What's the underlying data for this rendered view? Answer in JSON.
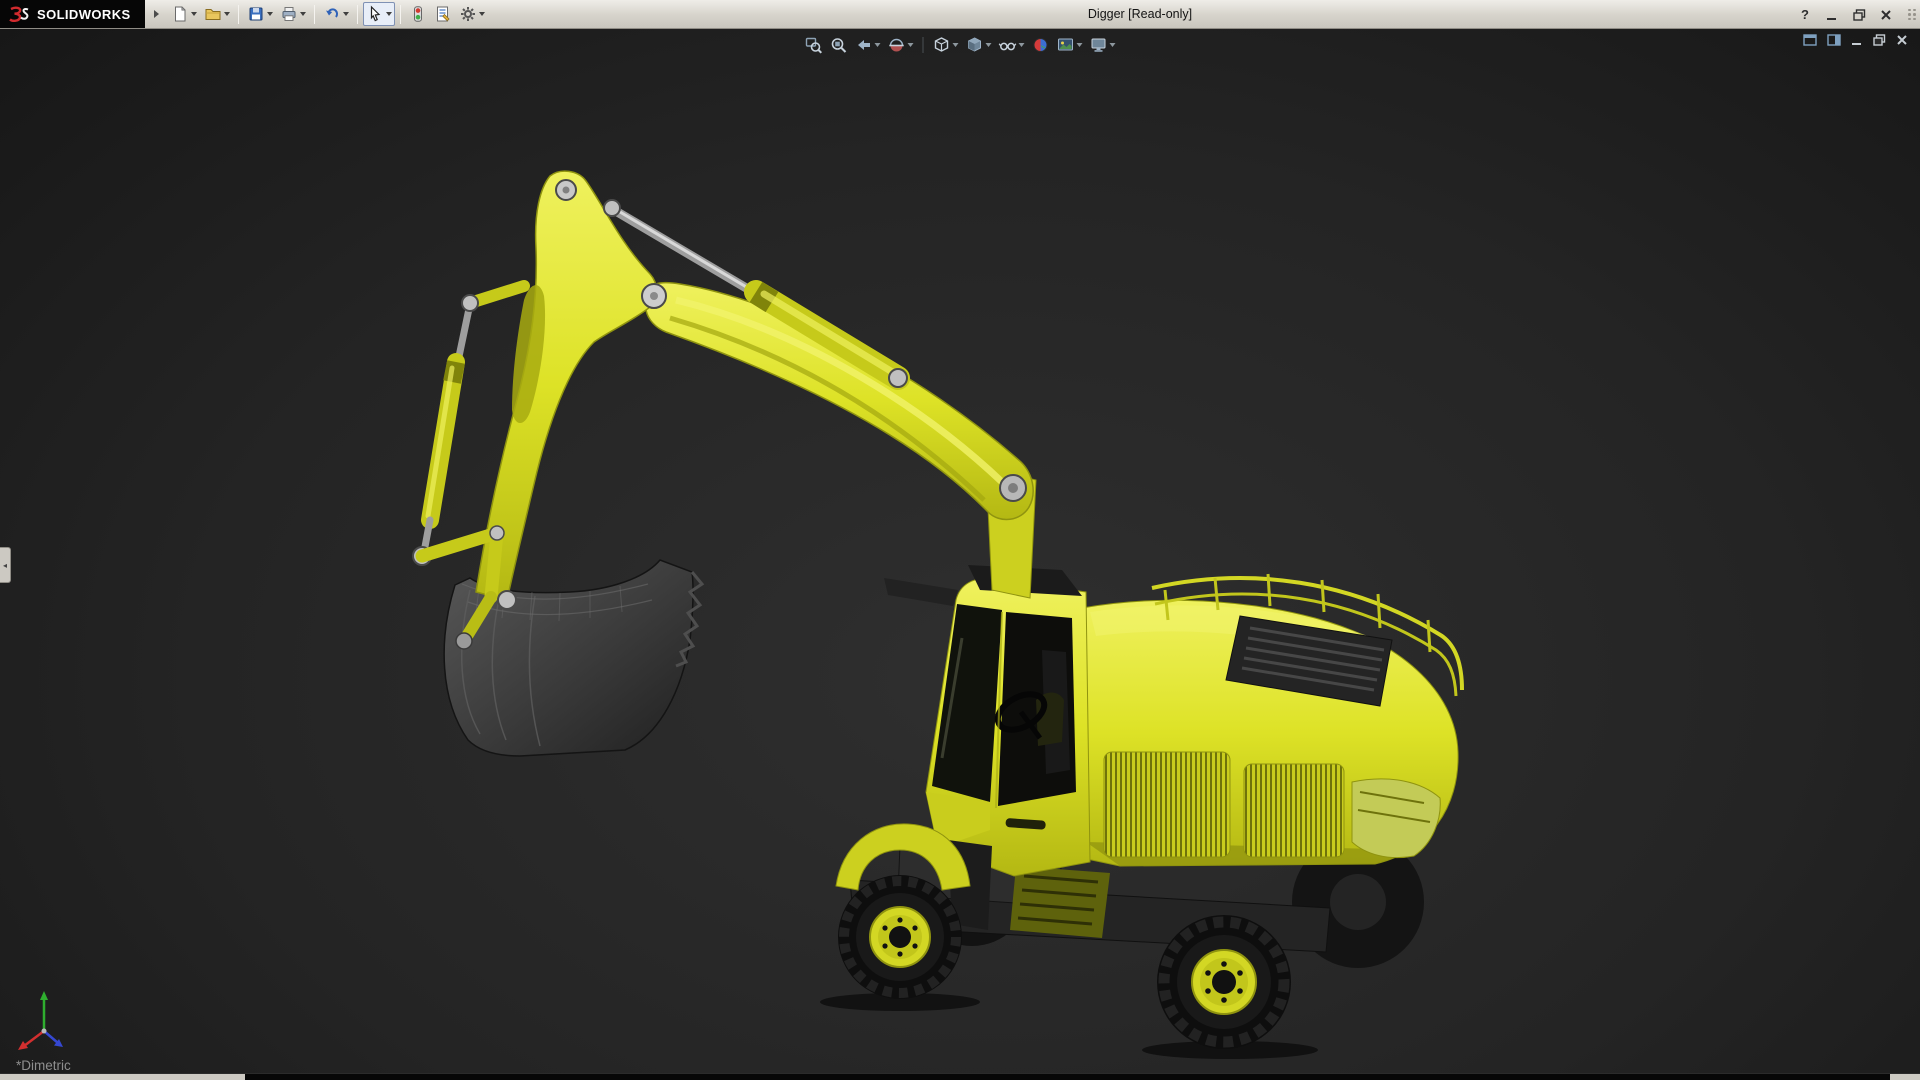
{
  "window": {
    "brand": "SOLIDWORKS",
    "title": "Digger [Read-only]",
    "help_glyph": "?"
  },
  "main_toolbar": {
    "icons": [
      {
        "name": "new-document",
        "dropdown": true
      },
      {
        "name": "open-document",
        "dropdown": true
      },
      {
        "name": "save",
        "dropdown": true
      },
      {
        "name": "print",
        "dropdown": true
      },
      {
        "name": "undo",
        "dropdown": true
      },
      {
        "name": "select",
        "dropdown": true,
        "active": true
      },
      {
        "name": "rebuild",
        "dropdown": false
      },
      {
        "name": "file-properties",
        "dropdown": false
      },
      {
        "name": "options",
        "dropdown": true
      }
    ]
  },
  "headsup_toolbar": {
    "icons": [
      {
        "name": "zoom-to-fit",
        "dropdown": false
      },
      {
        "name": "zoom-to-area",
        "dropdown": false
      },
      {
        "name": "previous-view",
        "dropdown": true
      },
      {
        "name": "section-view",
        "dropdown": true
      },
      {
        "name": "view-orientation",
        "dropdown": true
      },
      {
        "name": "display-style",
        "dropdown": true
      },
      {
        "name": "hide-show-items",
        "dropdown": true
      },
      {
        "name": "edit-appearance",
        "dropdown": false
      },
      {
        "name": "apply-scene",
        "dropdown": true
      },
      {
        "name": "view-settings",
        "dropdown": true
      }
    ]
  },
  "document_window_controls": [
    "doc-window-left",
    "doc-window-right",
    "doc-minimize",
    "doc-restore",
    "doc-close"
  ],
  "viewport": {
    "view_label": "*Dimetric",
    "model": "Digger wheeled excavator: yellow boom, stick and body, dark gray bucket, chassis and tires",
    "triad_colors": {
      "x": "#d22f2f",
      "y": "#2fae2f",
      "z": "#3548d2"
    }
  },
  "colors": {
    "model_yellow": "#dde226",
    "model_dark_gray": "#2e2e2e",
    "titlebar_bg": "#d3d0c8",
    "viewport_bg_center": "#2e2e2e",
    "viewport_bg_edge": "#161616"
  }
}
